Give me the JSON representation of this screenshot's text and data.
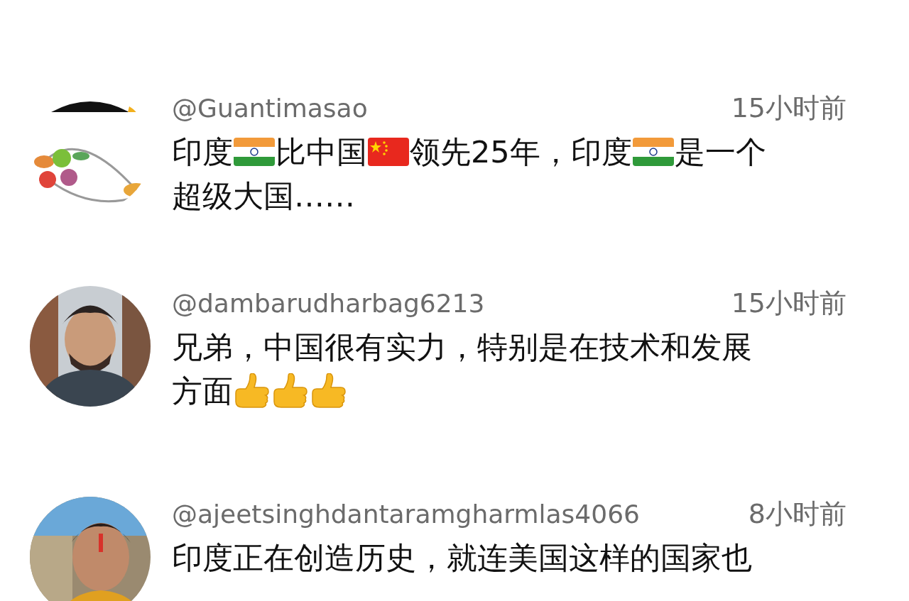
{
  "comments": [
    {
      "avatar": {
        "kind": "picture"
      },
      "username": "@Guantimasao",
      "time": "15小时前",
      "lines": [
        [
          {
            "kind": "text",
            "text": "印度"
          },
          {
            "kind": "indiaflag"
          },
          {
            "kind": "text",
            "text": "比中国"
          },
          {
            "kind": "chinaflag"
          },
          {
            "kind": "text",
            "text": "领先25年，印度"
          },
          {
            "kind": "indiaflag"
          },
          {
            "kind": "text",
            "text": "是一个"
          }
        ],
        [
          {
            "kind": "text",
            "text": "超级大国……"
          }
        ]
      ]
    },
    {
      "avatar": {
        "kind": "picture"
      },
      "username": "@dambarudharbag6213",
      "time": "15小时前",
      "lines": [
        [
          {
            "kind": "text",
            "text": "兄弟，中国很有实力，特别是在技术和发展"
          }
        ],
        [
          {
            "kind": "text",
            "text": "方面"
          },
          {
            "kind": "thumbsup"
          },
          {
            "kind": "thumbsup"
          },
          {
            "kind": "thumbsup"
          }
        ]
      ]
    },
    {
      "avatar": {
        "kind": "picture"
      },
      "username": "@ajeetsinghdantaramgharmlas4066",
      "time": "8小时前",
      "lines": [
        [
          {
            "kind": "text",
            "text": "印度正在创造历史，就连美国这样的国家也"
          }
        ]
      ]
    }
  ]
}
